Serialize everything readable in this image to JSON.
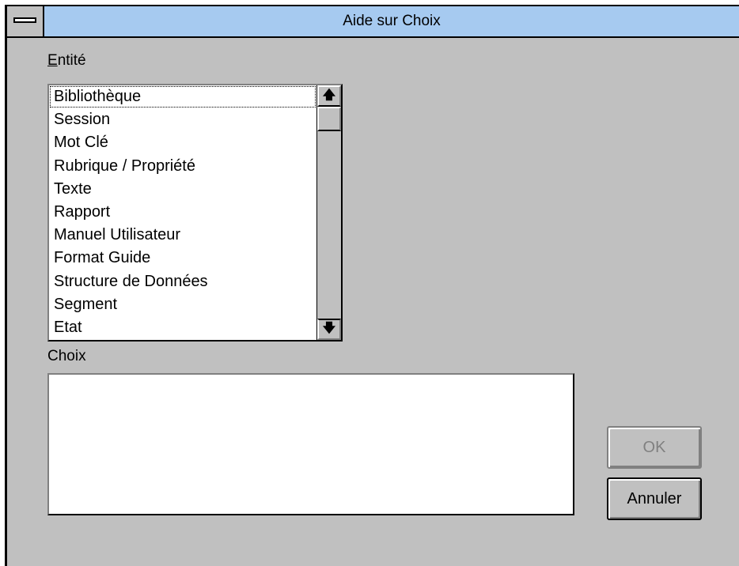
{
  "window": {
    "title": "Aide sur Choix"
  },
  "entite": {
    "label": "Entité",
    "items": [
      "Bibliothèque",
      "Session",
      "Mot Clé",
      "Rubrique / Propriété",
      "Texte",
      "Rapport",
      "Manuel Utilisateur",
      "Format Guide",
      "Structure de Données",
      "Segment",
      "Etat"
    ],
    "selected": "Bibliothèque",
    "scroll_up_icon": "arrow-up-icon",
    "scroll_down_icon": "arrow-down-icon"
  },
  "choix": {
    "label": "Choix",
    "value": ""
  },
  "buttons": {
    "ok_label": "OK",
    "ok_enabled": false,
    "cancel_label": "Annuler"
  },
  "colors": {
    "titlebar": "#a6caf0",
    "dialog_bg": "#c0c0c0",
    "disabled_text": "#808080"
  }
}
